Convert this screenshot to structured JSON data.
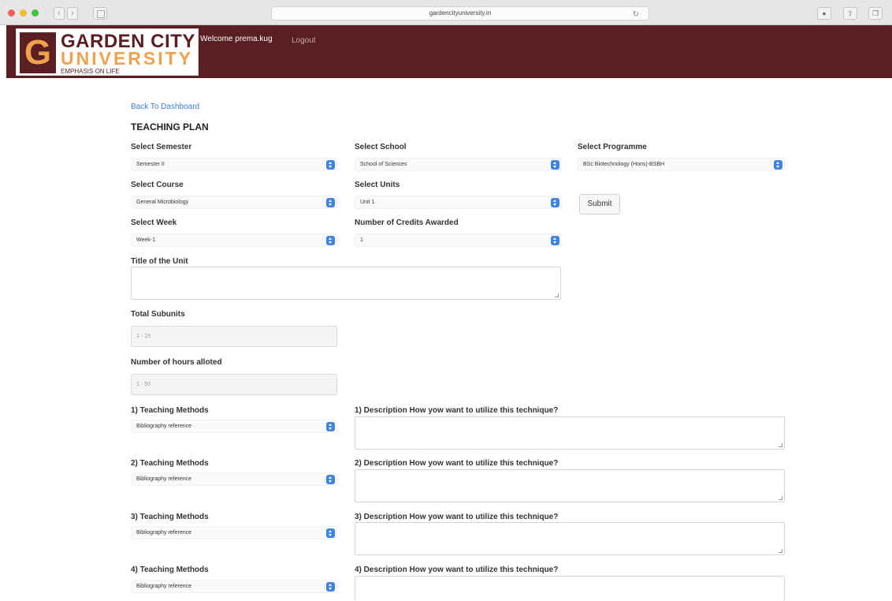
{
  "browser": {
    "url": "gardencityuniversity.in",
    "back_glyph": "‹",
    "forward_glyph": "›",
    "reload_glyph": "↻",
    "icons": [
      "reader-icon",
      "share-icon",
      "tabs-icon"
    ]
  },
  "header": {
    "logo_letter": "G",
    "logo_line1": "GARDEN CITY",
    "logo_line2": "UNIVERSITY",
    "logo_tagline": "EMPHASIS ON LIFE",
    "welcome": "Welcome prema.kug",
    "logout": "Logout",
    "brand_color": "#5a1f23",
    "accent_color": "#f0a14c"
  },
  "page": {
    "back_link": "Back To Dashboard",
    "title": "TEACHING PLAN"
  },
  "form": {
    "semester": {
      "label": "Select Semester",
      "value": "Semester II"
    },
    "school": {
      "label": "Select School",
      "value": "School of Sciences"
    },
    "programme": {
      "label": "Select Programme",
      "value": "BSc Biotechnology (Hons)-BSBH"
    },
    "course": {
      "label": "Select Course",
      "value": "General Microbiology"
    },
    "units": {
      "label": "Select Units",
      "value": "Unit 1"
    },
    "submit_label": "Submit",
    "week": {
      "label": "Select Week",
      "value": "Week-1"
    },
    "credits": {
      "label": "Number of Credits Awarded",
      "value": "1"
    },
    "unit_title": {
      "label": "Title of the Unit"
    },
    "subunits": {
      "label": "Total Subunits",
      "placeholder": "1 - 15"
    },
    "hours": {
      "label": "Number of hours alloted",
      "placeholder": "1 - 50"
    },
    "methods": [
      {
        "label": "1) Teaching Methods",
        "value": "Bibliography reference",
        "desc_label": "1) Description How yow want to utilize this technique?"
      },
      {
        "label": "2) Teaching Methods",
        "value": "Bibliography reference",
        "desc_label": "2) Description How yow want to utilize this technique?"
      },
      {
        "label": "3) Teaching Methods",
        "value": "Bibliography reference",
        "desc_label": "3) Description How yow want to utilize this technique?"
      },
      {
        "label": "4) Teaching Methods",
        "value": "Bibliography reference",
        "desc_label": "4) Description How yow want to utilize this technique?"
      }
    ]
  }
}
